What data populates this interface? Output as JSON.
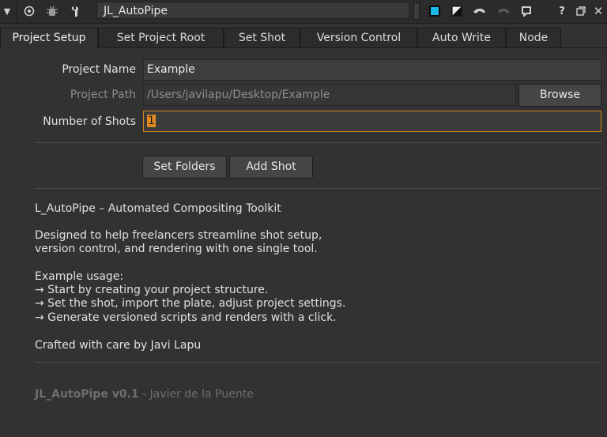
{
  "toolbar": {
    "node_name": "JL_AutoPipe"
  },
  "tabs": [
    {
      "label": "Project Setup",
      "active": true
    },
    {
      "label": "Set Project Root"
    },
    {
      "label": "Set Shot"
    },
    {
      "label": "Version Control"
    },
    {
      "label": "Auto Write"
    },
    {
      "label": "Node"
    }
  ],
  "form": {
    "project_name_label": "Project Name",
    "project_name_value": "Example",
    "project_path_label": "Project Path",
    "project_path_value": "/Users/javilapu/Desktop/Example",
    "browse_label": "Browse",
    "shots_label": "Number of Shots",
    "shots_value": "1"
  },
  "actions": {
    "set_folders_label": "Set Folders",
    "add_shot_label": "Add Shot"
  },
  "description": {
    "title": "L_AutoPipe – Automated Compositing Toolkit",
    "para1_line1": "Designed to help freelancers streamline shot setup,",
    "para1_line2": "version control, and rendering with one single tool.",
    "usage_header": "Example usage:",
    "usage_1": "→ Start by creating your project structure.",
    "usage_2": "→ Set the shot, import the plate, adjust project settings.",
    "usage_3": "→ Generate versioned scripts and renders with a click.",
    "credit": "Crafted with care by Javi Lapu"
  },
  "footer": {
    "version": "JL_AutoPipe v0.1",
    "author": " - Javier de la Puente"
  },
  "colors": {
    "accent_focus": "#d9821b",
    "node_color_swatch": "#19b8e6"
  }
}
